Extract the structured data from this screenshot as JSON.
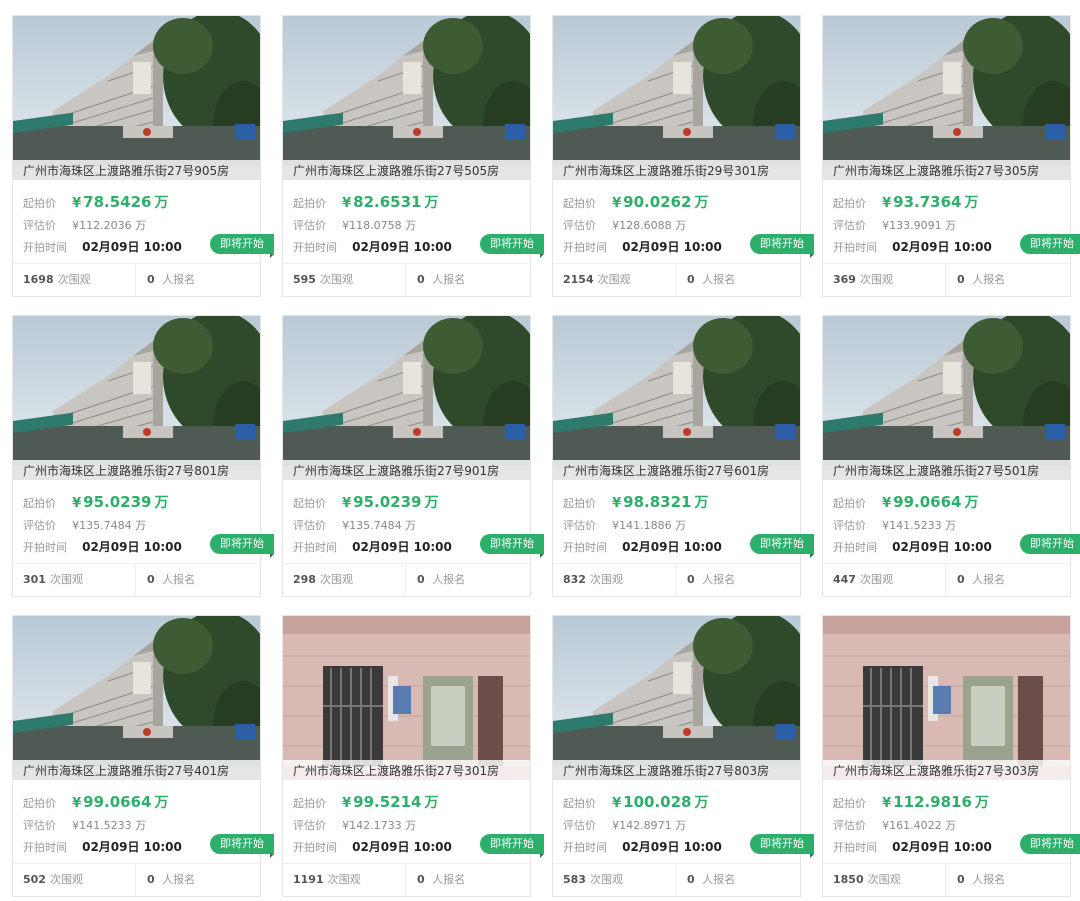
{
  "labels": {
    "start_price": "起拍价",
    "eval_price": "评估价",
    "start_time": "开拍时间",
    "currency": "¥",
    "unit": "万",
    "badge": "即将开始",
    "views_suffix": "次围观",
    "regs_suffix": "人报名"
  },
  "colors": {
    "accent": "#2daf6b"
  },
  "listings": [
    {
      "title": "广州市海珠区上渡路雅乐街27号905房",
      "start": "78.5426",
      "eval": "¥112.2036 万",
      "time": "02月09日 10:00",
      "views": "1698",
      "regs": "0",
      "image": "building"
    },
    {
      "title": "广州市海珠区上渡路雅乐街27号505房",
      "start": "82.6531",
      "eval": "¥118.0758 万",
      "time": "02月09日 10:00",
      "views": "595",
      "regs": "0",
      "image": "building"
    },
    {
      "title": "广州市海珠区上渡路雅乐街29号301房",
      "start": "90.0262",
      "eval": "¥128.6088 万",
      "time": "02月09日 10:00",
      "views": "2154",
      "regs": "0",
      "image": "building"
    },
    {
      "title": "广州市海珠区上渡路雅乐街27号305房",
      "start": "93.7364",
      "eval": "¥133.9091 万",
      "time": "02月09日 10:00",
      "views": "369",
      "regs": "0",
      "image": "building"
    },
    {
      "title": "广州市海珠区上渡路雅乐街27号801房",
      "start": "95.0239",
      "eval": "¥135.7484 万",
      "time": "02月09日 10:00",
      "views": "301",
      "regs": "0",
      "image": "building"
    },
    {
      "title": "广州市海珠区上渡路雅乐街27号901房",
      "start": "95.0239",
      "eval": "¥135.7484 万",
      "time": "02月09日 10:00",
      "views": "298",
      "regs": "0",
      "image": "building"
    },
    {
      "title": "广州市海珠区上渡路雅乐街27号601房",
      "start": "98.8321",
      "eval": "¥141.1886 万",
      "time": "02月09日 10:00",
      "views": "832",
      "regs": "0",
      "image": "building"
    },
    {
      "title": "广州市海珠区上渡路雅乐街27号501房",
      "start": "99.0664",
      "eval": "¥141.5233 万",
      "time": "02月09日 10:00",
      "views": "447",
      "regs": "0",
      "image": "building"
    },
    {
      "title": "广州市海珠区上渡路雅乐街27号401房",
      "start": "99.0664",
      "eval": "¥141.5233 万",
      "time": "02月09日 10:00",
      "views": "502",
      "regs": "0",
      "image": "building"
    },
    {
      "title": "广州市海珠区上渡路雅乐街27号301房",
      "start": "99.5214",
      "eval": "¥142.1733 万",
      "time": "02月09日 10:00",
      "views": "1191",
      "regs": "0",
      "image": "gate"
    },
    {
      "title": "广州市海珠区上渡路雅乐街27号803房",
      "start": "100.028",
      "eval": "¥142.8971 万",
      "time": "02月09日 10:00",
      "views": "583",
      "regs": "0",
      "image": "building"
    },
    {
      "title": "广州市海珠区上渡路雅乐街27号303房",
      "start": "112.9816",
      "eval": "¥161.4022 万",
      "time": "02月09日 10:00",
      "views": "1850",
      "regs": "0",
      "image": "gate"
    }
  ]
}
